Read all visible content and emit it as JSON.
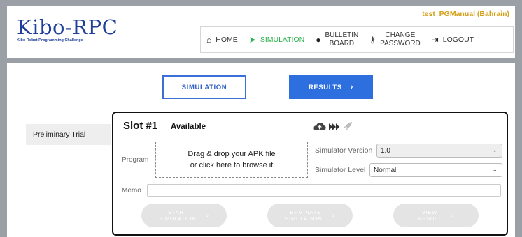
{
  "header": {
    "logo_title": "Kibo-RPC",
    "logo_subtitle": "Kibo Robot Programming Challenge",
    "user_label": "test_PGManual (Bahrain)",
    "nav": [
      {
        "icon": "home-icon",
        "glyph": "⌂",
        "line1": "HOME",
        "line2": ""
      },
      {
        "icon": "paper-plane-icon",
        "glyph": "➤",
        "line1": "SIMULATION",
        "line2": ""
      },
      {
        "icon": "chat-bubbles-icon",
        "glyph": "●",
        "line1": "BULLETIN",
        "line2": "BOARD"
      },
      {
        "icon": "key-icon",
        "glyph": "⚷",
        "line1": "CHANGE",
        "line2": "PASSWORD"
      },
      {
        "icon": "logout-icon",
        "glyph": "⇥",
        "line1": "LOGOUT",
        "line2": ""
      }
    ],
    "active_nav": "SIMULATION",
    "active_color": "#2bb24c"
  },
  "tabs": {
    "simulation_label": "SIMULATION",
    "results_label": "RESULTS",
    "results_arrow": "›"
  },
  "sidebar": {
    "items": [
      "Preliminary Trial"
    ]
  },
  "slot": {
    "title": "Slot #1",
    "status": "Available",
    "icons": [
      "cloud-upload-icon",
      "fast-forward-icon",
      "rocket-icon"
    ],
    "program_label": "Program",
    "dropzone_line1": "Drag & drop your APK file",
    "dropzone_line2": "or click here to browse it",
    "sim_version_label": "Simulator Version",
    "sim_version_value": "1.0",
    "sim_level_label": "Simulator Level",
    "sim_level_value": "Normal",
    "memo_label": "Memo",
    "memo_value": "",
    "buttons": {
      "start_line1": "START",
      "start_line2": "SIMULATION",
      "terminate_line1": "TERMINATE",
      "terminate_line2": "SIMULATION",
      "view_line1": "VIEW",
      "view_line2": "RESULT",
      "arrow": "›"
    }
  },
  "colors": {
    "brand_blue": "#1f3f9a",
    "accent_blue": "#2e6fe0",
    "user_gold": "#d4a017"
  }
}
